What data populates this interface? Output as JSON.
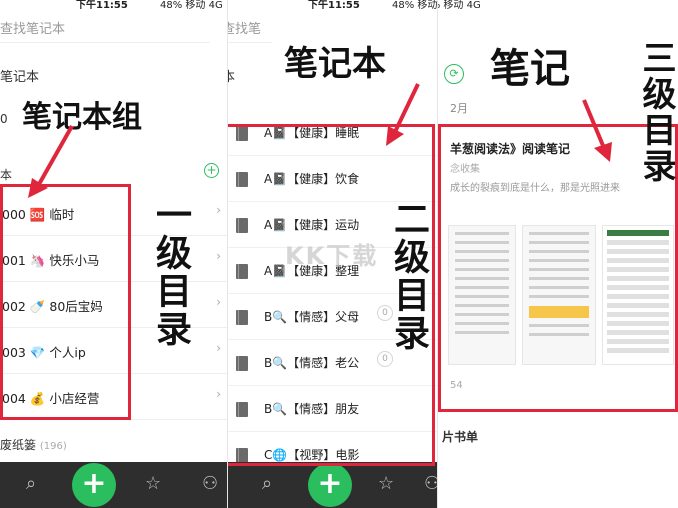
{
  "status": {
    "time": "下午11:55",
    "right": "48% 移动 4G"
  },
  "panel1": {
    "search_placeholder": "查找笔记本",
    "section_notebooks": "笔记本",
    "section_zero": "0",
    "section_books": "本",
    "items": [
      {
        "label": "000 🆘 临时"
      },
      {
        "label": "001 🦄 快乐小马"
      },
      {
        "label": "002 🍼 80后宝妈"
      },
      {
        "label": "003 💎 个人ip"
      },
      {
        "label": "004 💰 小店经营"
      }
    ],
    "trash_label": "废纸篓",
    "trash_count": "(196)"
  },
  "panel2": {
    "search_placeholder": "查找笔",
    "header_label": "本",
    "items": [
      {
        "label": "A📓【健康】睡眠",
        "count": ""
      },
      {
        "label": "A📓【健康】饮食",
        "count": ""
      },
      {
        "label": "A📓【健康】运动",
        "count": ""
      },
      {
        "label": "A📓【健康】整理",
        "count": ""
      },
      {
        "label": "B🔍【情感】父母",
        "count": "0"
      },
      {
        "label": "B🔍【情感】老公",
        "count": "0"
      },
      {
        "label": "B🔍【情感】朋友",
        "count": ""
      },
      {
        "label": "C🌐【视野】电影",
        "count": ""
      }
    ]
  },
  "panel3": {
    "date": "2月",
    "note_title": "羊葱阅读法》阅读笔记",
    "note_sub": "念收集",
    "note_quote": "成长的裂痕到底是什么，那是光照进来",
    "footer_num": "54",
    "footer_title": "片书单"
  },
  "annotations": {
    "notebook_group": "笔记本组",
    "notebook": "笔记本",
    "note": "笔记",
    "level1": "一级目录",
    "level2": "二级目录",
    "level3": "三级目录"
  },
  "watermark": "KK下载",
  "colors": {
    "annotation_red": "#e0263d",
    "fab_green": "#2bbe5e",
    "tabbar": "#2e2e2e"
  },
  "tabbar_icons": [
    "search-icon",
    "add-icon",
    "star-icon",
    "person-icon"
  ]
}
